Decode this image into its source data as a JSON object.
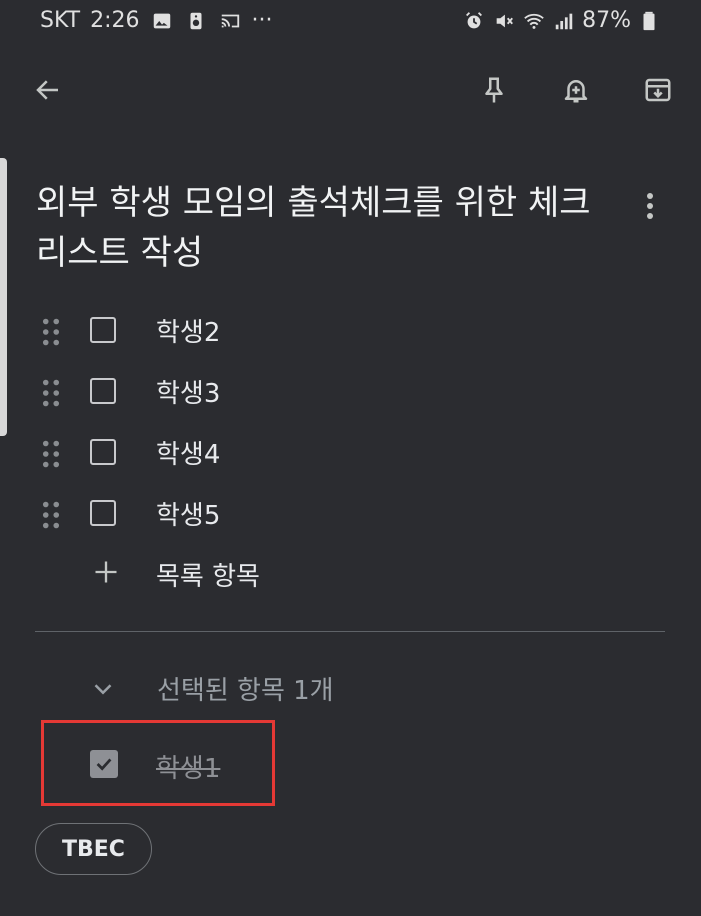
{
  "status_bar": {
    "carrier": "SKT",
    "time": "2:26",
    "dots": "···",
    "battery": "87%"
  },
  "note": {
    "title": "외부 학생 모임의 출석체크를 위한 체크리스트 작성",
    "items": [
      {
        "label": "학생2",
        "checked": false
      },
      {
        "label": "학생3",
        "checked": false
      },
      {
        "label": "학생4",
        "checked": false
      },
      {
        "label": "학생5",
        "checked": false
      }
    ],
    "add_item_label": "목록 항목",
    "checked_section_label": "선택된 항목 1개",
    "checked_items": [
      {
        "label": "학생1",
        "checked": true
      }
    ],
    "label_chip": "TBEC"
  },
  "colors": {
    "background": "#2b2c30",
    "highlight": "#e53935"
  }
}
